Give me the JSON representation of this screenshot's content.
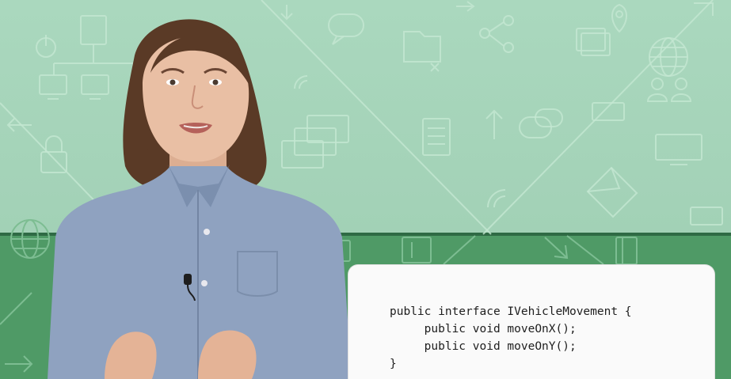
{
  "code_snippet": {
    "lines": [
      "public interface IVehicleMovement {",
      "     public void moveOnX();",
      "     public void moveOnY();",
      "}"
    ]
  },
  "colors": {
    "background_top": "#a6d4b9",
    "background_bottom": "#4f9a66",
    "divider": "#2f6a44",
    "card": "#fafafa",
    "shirt": "#8fa2c0",
    "hair": "#5a3a26",
    "skin": "#e9bfa4"
  },
  "icons": [
    "monitor-icon",
    "network-icon",
    "lock-icon",
    "folder-icon",
    "chat-icon",
    "globe-icon",
    "document-icon",
    "envelope-icon",
    "users-icon",
    "location-pin-icon",
    "wifi-icon",
    "arrow-icon"
  ]
}
